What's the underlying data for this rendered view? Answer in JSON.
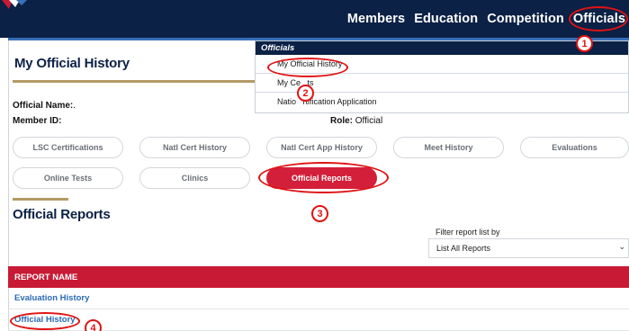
{
  "nav": {
    "items": [
      "Members",
      "Education",
      "Competition",
      "Officials"
    ]
  },
  "page": {
    "title": "My Official History"
  },
  "dropdown": {
    "header": "Officials",
    "items": [
      "My Official History",
      "My Ce   ts",
      "Natio   rtification Application"
    ]
  },
  "info": {
    "official_name_label": "Official Name:",
    "official_name_value": ".",
    "member_id_label": "Member ID:",
    "role_label": "Role:",
    "role_value": "Official"
  },
  "tabs": {
    "row1": [
      "LSC Certifications",
      "Natl Cert History",
      "Natl Cert App History",
      "Meet History",
      "Evaluations"
    ],
    "row2": [
      "Online Tests",
      "Clinics",
      "Official Reports"
    ]
  },
  "section": {
    "title": "Official Reports"
  },
  "filter": {
    "label": "Filter report list by",
    "selected": "List All Reports"
  },
  "table": {
    "header": "REPORT NAME",
    "rows": [
      "Evaluation History",
      "Official History"
    ]
  },
  "annotations": [
    "1",
    "2",
    "3",
    "4"
  ],
  "colors": {
    "navy": "#0b2145",
    "accent_red": "#d31f3a",
    "gold": "#b49a63",
    "link_blue": "#2a6ab3",
    "annotation_red": "#e01313"
  }
}
